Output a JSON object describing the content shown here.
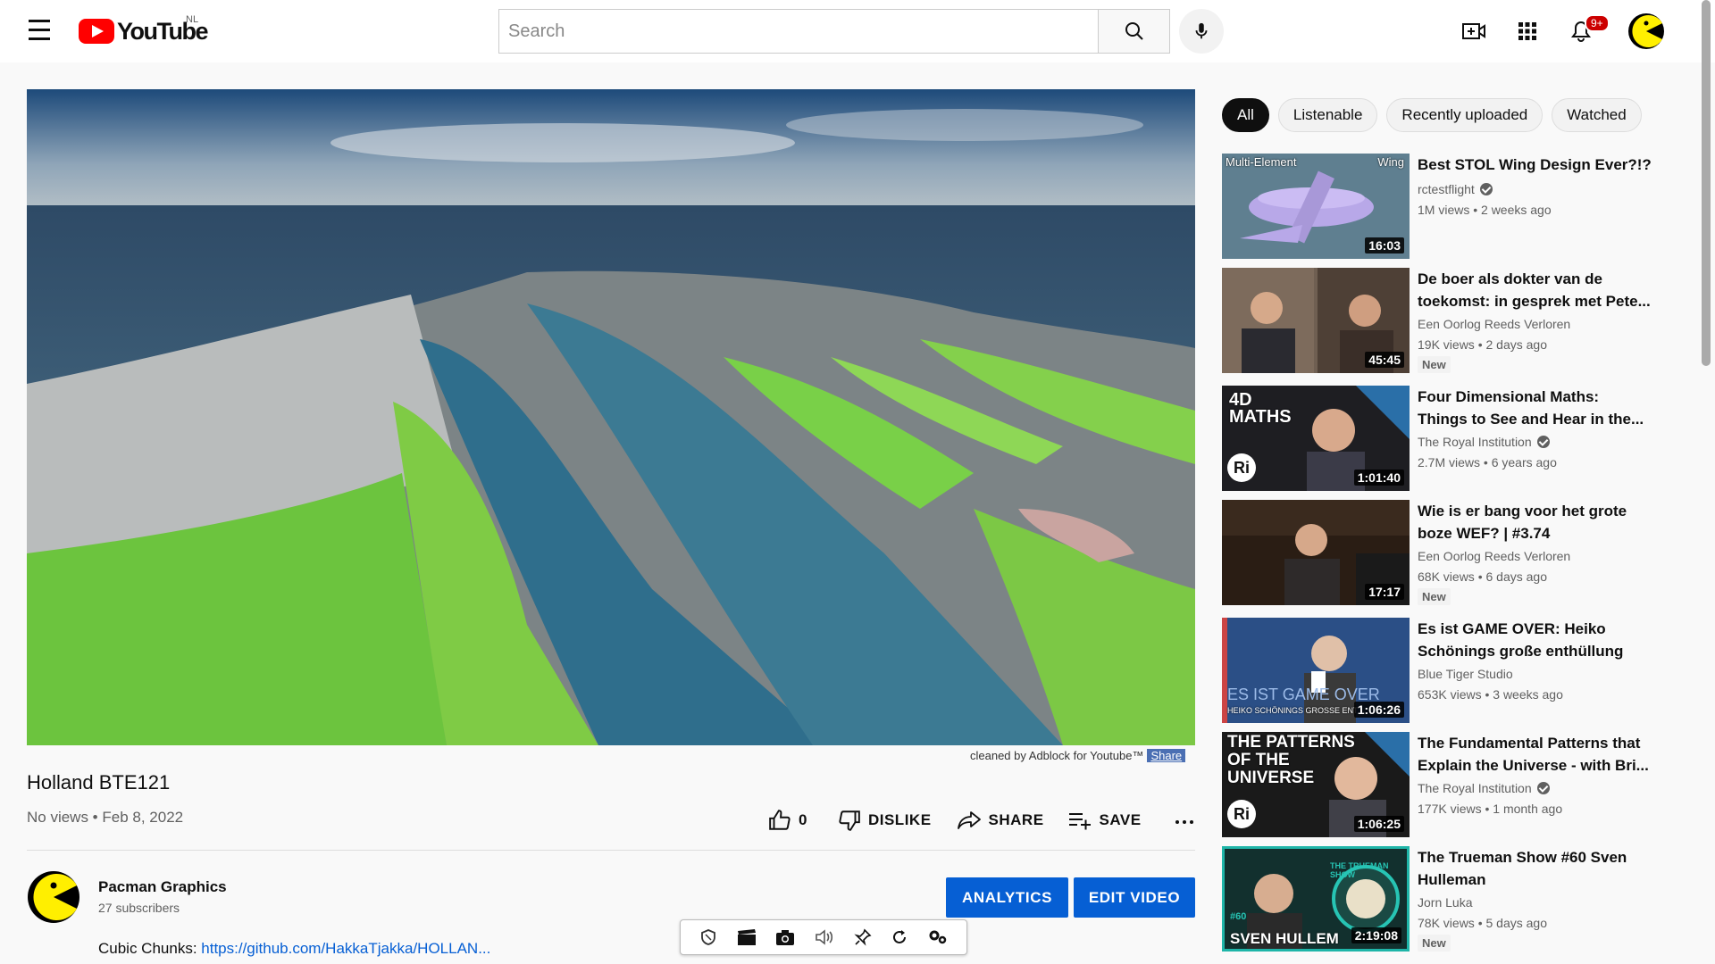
{
  "header": {
    "logo_text": "YouTube",
    "country": "NL",
    "search_placeholder": "Search",
    "notifications_badge": "9+"
  },
  "video": {
    "title": "Holland BTE121",
    "meta": "No views • Feb 8, 2022",
    "adblock_note": "cleaned by Adblock for Youtube™",
    "adblock_share": "Share"
  },
  "actions": {
    "like_count": "0",
    "dislike": "DISLIKE",
    "share": "SHARE",
    "save": "SAVE"
  },
  "channel": {
    "name": "Pacman Graphics",
    "subscribers": "27 subscribers",
    "analytics": "ANALYTICS",
    "edit_video": "EDIT VIDEO"
  },
  "description": {
    "prefix": "Cubic Chunks: ",
    "link": "https://github.com/HakkaTjakka/HOLLAN..."
  },
  "chips": [
    "All",
    "Listenable",
    "Recently uploaded",
    "Watched"
  ],
  "recommendations": [
    {
      "title": "Best STOL Wing Design Ever?!?",
      "channel": "rctestflight",
      "verified": true,
      "views": "1M views • 2 weeks ago",
      "duration": "16:03",
      "new": false,
      "thumb_text_1": "Multi-Element",
      "thumb_text_2": "Wing"
    },
    {
      "title": "De boer als dokter van de toekomst: in gesprek met Pete...",
      "channel": "Een Oorlog Reeds Verloren",
      "verified": false,
      "views": "19K views • 2 days ago",
      "duration": "45:45",
      "new": true,
      "new_label": "New"
    },
    {
      "title": "Four Dimensional Maths: Things to See and Hear in the...",
      "channel": "The Royal Institution",
      "verified": true,
      "views": "2.7M views • 6 years ago",
      "duration": "1:01:40",
      "new": false,
      "thumb_text_1": "4D",
      "thumb_text_2": "MATHS",
      "thumb_text_3": "Ri"
    },
    {
      "title": "Wie is er bang voor het grote boze WEF? | #3.74",
      "channel": "Een Oorlog Reeds Verloren",
      "verified": false,
      "views": "68K views • 6 days ago",
      "duration": "17:17",
      "new": true,
      "new_label": "New"
    },
    {
      "title": "Es ist GAME OVER: Heiko Schönings große enthüllung",
      "channel": "Blue Tiger Studio",
      "verified": false,
      "views": "653K views • 3 weeks ago",
      "duration": "1:06:26",
      "new": false,
      "thumb_text_1": "ES IST GAME OVER",
      "thumb_text_2": "HEIKO SCHÖNINGS GROSSE ENT"
    },
    {
      "title": "The Fundamental Patterns that Explain the Universe - with Bri...",
      "channel": "The Royal Institution",
      "verified": true,
      "views": "177K views • 1 month ago",
      "duration": "1:06:25",
      "new": false,
      "thumb_text_1": "THE PATTERNS",
      "thumb_text_2": "OF THE",
      "thumb_text_3": "UNIVERSE",
      "thumb_text_4": "Ri"
    },
    {
      "title": "The Trueman Show #60 Sven Hulleman",
      "channel": "Jorn Luka",
      "verified": false,
      "views": "78K views • 5 days ago",
      "duration": "2:19:08",
      "new": true,
      "new_label": "New",
      "thumb_text_1": "SVEN HULLEM",
      "thumb_text_2": "#60",
      "thumb_text_3": "THE TRUEMAN SHOW"
    }
  ],
  "colors": {
    "accent_blue": "#065fd4",
    "brand_red": "#ff0000"
  }
}
